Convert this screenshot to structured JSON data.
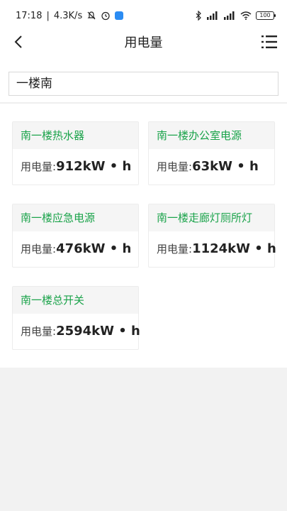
{
  "status_bar": {
    "time": "17:18",
    "speed": "4.3K/s",
    "battery": "100"
  },
  "header": {
    "title": "用电量"
  },
  "search": {
    "value": "一楼南"
  },
  "usage_label": "用电量:",
  "unit": "kW • h",
  "cards": [
    {
      "name": "南一楼热水器",
      "value": "912"
    },
    {
      "name": "南一楼办公室电源",
      "value": "63"
    },
    {
      "name": "南一楼应急电源",
      "value": "476"
    },
    {
      "name": "南一楼走廊灯厕所灯",
      "value": "1124"
    },
    {
      "name": "南一楼总开关",
      "value": "2594"
    }
  ],
  "colors": {
    "accent_green": "#1aa34a",
    "card_header_bg": "#f5f5f5",
    "page_bg": "#f2f2f2"
  }
}
